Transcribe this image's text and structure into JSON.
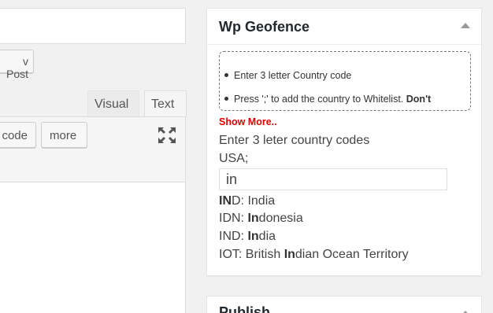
{
  "editor": {
    "view_post_label": "v Post",
    "tabs": [
      {
        "label": "Visual"
      },
      {
        "label": "Text"
      }
    ],
    "quicktags": [
      {
        "label": "code"
      },
      {
        "label": "more"
      }
    ],
    "fullscreen_icon": "fullscreen-icon"
  },
  "geofence": {
    "title": "Wp Geofence",
    "instructions": [
      {
        "text": "Enter 3 letter Country code",
        "bold_tail": ""
      },
      {
        "text": "Press ';' to add the country to Whitelist. ",
        "bold_tail": "Don't"
      }
    ],
    "show_more": "Show More..",
    "prompt_label": "Enter 3 leter country codes",
    "selected_codes": "USA;",
    "input_value": "in",
    "suggestions": [
      {
        "parts": [
          {
            "t": "IN",
            "b": true
          },
          {
            "t": "D: India",
            "b": false
          }
        ]
      },
      {
        "parts": [
          {
            "t": "IDN: ",
            "b": false
          },
          {
            "t": "In",
            "b": true
          },
          {
            "t": "donesia",
            "b": false
          }
        ]
      },
      {
        "parts": [
          {
            "t": "IND: ",
            "b": false
          },
          {
            "t": "In",
            "b": true
          },
          {
            "t": "dia",
            "b": false
          }
        ]
      },
      {
        "parts": [
          {
            "t": "IOT: British ",
            "b": false
          },
          {
            "t": "In",
            "b": true
          },
          {
            "t": "dian Ocean Territory",
            "b": false
          }
        ]
      }
    ],
    "colors": {
      "show_more": "#dd0000",
      "border": "#e5e5e5"
    }
  },
  "publish": {
    "title": "Publish"
  }
}
